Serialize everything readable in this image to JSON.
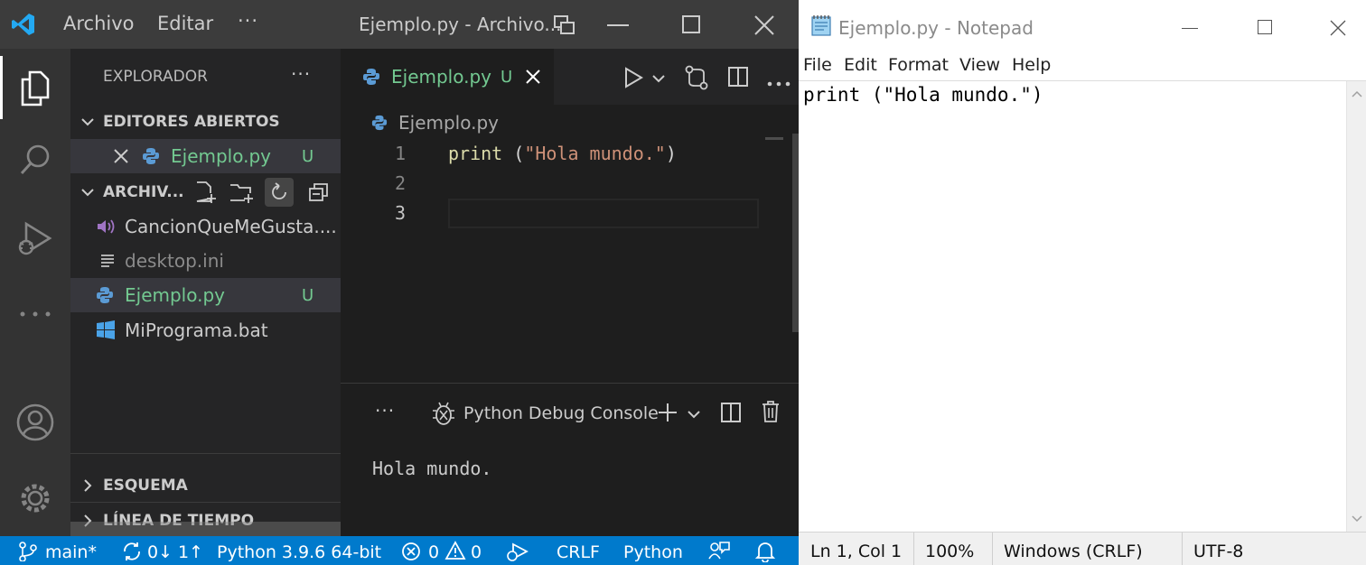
{
  "vscode": {
    "titlebar": {
      "menu_file": "Archivo",
      "menu_edit": "Editar",
      "more": "···",
      "title": "Ejemplo.py - Archivo..."
    },
    "sidebar": {
      "header": "EXPLORADOR",
      "more": "···",
      "open_editors": "EDITORES ABIERTOS",
      "open_editor_item": {
        "name": "Ejemplo.py",
        "badge": "U"
      },
      "folder": "ARCHIV...",
      "files": [
        {
          "name": "CancionQueMeGusta....",
          "icon": "audio-icon"
        },
        {
          "name": "desktop.ini",
          "icon": "text-file-icon"
        },
        {
          "name": "Ejemplo.py",
          "icon": "python-icon",
          "badge": "U"
        },
        {
          "name": "MiPrograma.bat",
          "icon": "windows-icon"
        }
      ],
      "outline": "ESQUEMA",
      "timeline": "LÍNEA DE TIEMPO"
    },
    "editor": {
      "tab": {
        "name": "Ejemplo.py",
        "badge": "U"
      },
      "breadcrumb": "Ejemplo.py",
      "line_numbers": [
        "1",
        "2",
        "3"
      ],
      "code": {
        "fn": "print",
        "open": " (",
        "str": "\"Hola mundo.\"",
        "close": ")"
      }
    },
    "panel": {
      "more": "···",
      "console": "Python Debug Console",
      "output": "Hola mundo."
    },
    "statusbar": {
      "branch": "main*",
      "sync": "0↓ 1↑",
      "interpreter": "Python 3.9.6 64-bit",
      "errors": "0",
      "warnings": "0",
      "eol": "CRLF",
      "language": "Python"
    },
    "colors": {
      "accent": "#007acc",
      "untracked": "#73c991",
      "python_blue": "#4b8bbe"
    }
  },
  "notepad": {
    "title": "Ejemplo.py - Notepad",
    "menu": [
      "File",
      "Edit",
      "Format",
      "View",
      "Help"
    ],
    "content": "print (\"Hola mundo.\")",
    "status": {
      "position": "Ln 1, Col 1",
      "zoom": "100%",
      "eol": "Windows (CRLF)",
      "encoding": "UTF-8"
    }
  }
}
